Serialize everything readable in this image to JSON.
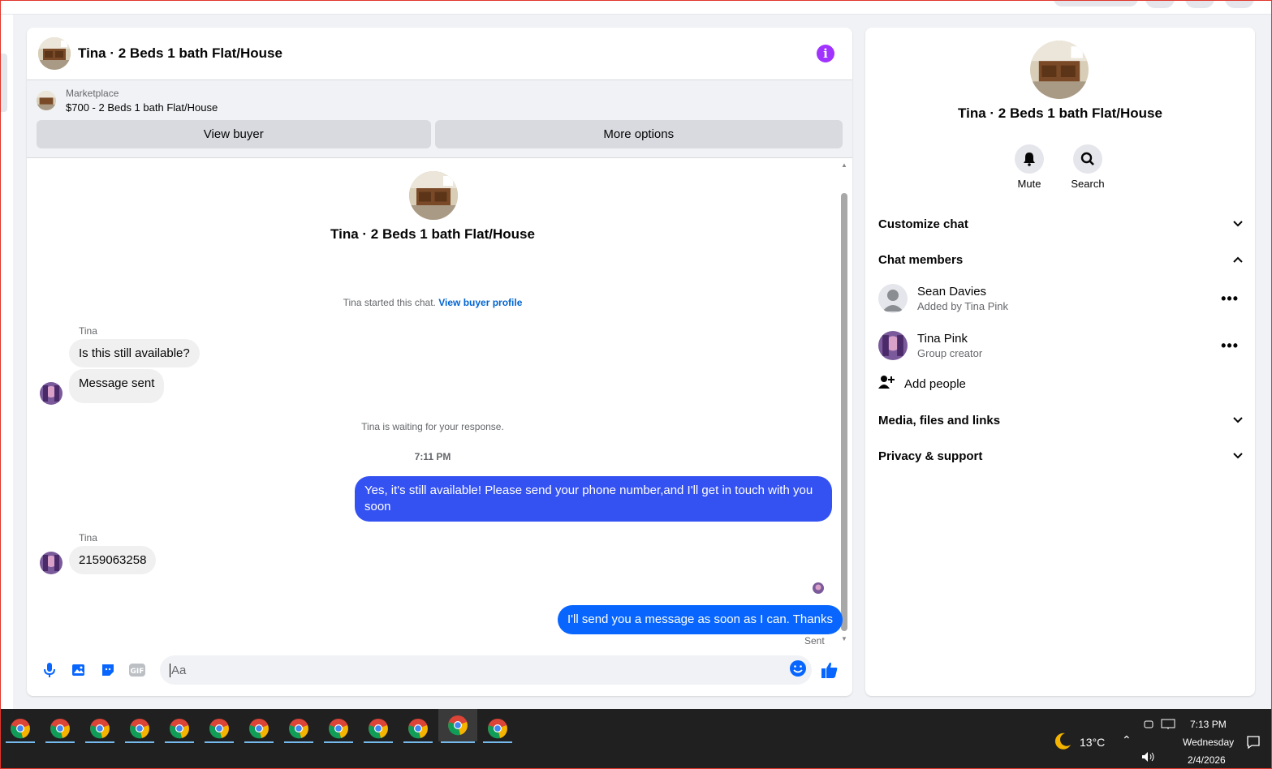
{
  "chat": {
    "title": "Tina · 2 Beds 1 bath Flat/House",
    "marketplace_label": "Marketplace",
    "listing": "$700 - 2 Beds 1 bath Flat/House",
    "view_buyer": "View buyer",
    "more_options": "More options",
    "thread_title": "Tina · 2 Beds 1 bath Flat/House",
    "started_text": "Tina started this chat.",
    "view_buyer_profile": "View buyer profile",
    "waiting_text": "Tina is waiting for your response.",
    "timestamp": "7:11 PM",
    "sent_label": "Sent",
    "composer_placeholder": "Aa",
    "messages": [
      {
        "sender": "Tina",
        "text": "Is this still available?"
      },
      {
        "text": "Message sent"
      },
      {
        "text": "Yes, it's still available! Please send your phone number,and I'll get in touch with you soon"
      },
      {
        "sender": "Tina",
        "text": "2159063258"
      },
      {
        "text": "I'll send you a message as soon as I can. Thanks"
      }
    ]
  },
  "sidebar": {
    "title": "Tina · 2 Beds 1 bath Flat/House",
    "mute": "Mute",
    "search": "Search",
    "customize_chat": "Customize chat",
    "chat_members": "Chat members",
    "members": [
      {
        "name": "Sean Davies",
        "sub": "Added by Tina Pink"
      },
      {
        "name": "Tina Pink",
        "sub": "Group creator"
      }
    ],
    "add_people": "Add people",
    "media": "Media, files and links",
    "privacy": "Privacy & support"
  },
  "taskbar": {
    "temperature": "13°C",
    "time": "7:13 PM",
    "day": "Wednesday",
    "date": "2/4/2026"
  },
  "colors": {
    "accent": "#0866ff",
    "outgoing_bubble": "#3451f2",
    "info": "#a033ff"
  }
}
